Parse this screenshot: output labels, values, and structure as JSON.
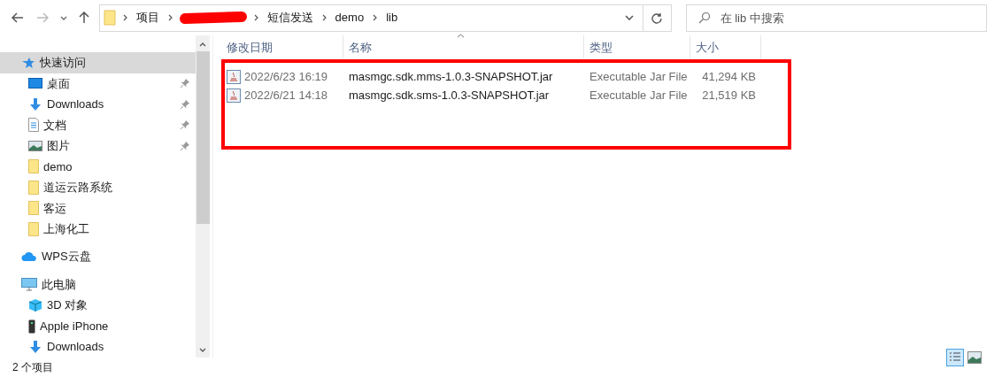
{
  "address_bar": {
    "segments": [
      {
        "kind": "text",
        "label": "项目"
      },
      {
        "kind": "redacted"
      },
      {
        "kind": "text",
        "label": "短信发送"
      },
      {
        "kind": "text",
        "label": "demo"
      },
      {
        "kind": "text",
        "label": "lib"
      }
    ]
  },
  "search": {
    "placeholder": "在 lib 中搜索"
  },
  "sidebar": {
    "items": [
      {
        "label": "快速访问",
        "kind": "star",
        "selected": true,
        "children": [
          {
            "label": "桌面",
            "kind": "desktop",
            "pinned": true,
            "selected": false
          },
          {
            "label": "Downloads",
            "kind": "download",
            "pinned": true,
            "selected": false
          },
          {
            "label": "文档",
            "kind": "document",
            "pinned": true,
            "selected": false
          },
          {
            "label": "图片",
            "kind": "image",
            "pinned": true,
            "selected": false
          },
          {
            "label": "demo",
            "kind": "folder",
            "pinned": false,
            "selected": false
          },
          {
            "label": "道运云路系统",
            "kind": "folder",
            "pinned": false,
            "selected": false
          },
          {
            "label": "客运",
            "kind": "folder",
            "pinned": false,
            "selected": false
          },
          {
            "label": "上海化工",
            "kind": "folder",
            "pinned": false,
            "selected": false
          }
        ]
      },
      {
        "label": "WPS云盘",
        "kind": "cloud",
        "selected": false
      },
      {
        "label": "此电脑",
        "kind": "pc",
        "selected": false,
        "children": [
          {
            "label": "3D 对象",
            "kind": "cube",
            "selected": false
          },
          {
            "label": "Apple iPhone",
            "kind": "phone",
            "selected": false
          },
          {
            "label": "Downloads",
            "kind": "download",
            "selected": false
          }
        ]
      }
    ]
  },
  "table": {
    "columns": [
      {
        "label": "修改日期",
        "sorted": false
      },
      {
        "label": "名称",
        "sorted": true
      },
      {
        "label": "类型",
        "sorted": false
      },
      {
        "label": "大小",
        "sorted": false
      }
    ],
    "rows": [
      {
        "date": "2022/6/23 16:19",
        "name": "masmgc.sdk.mms-1.0.3-SNAPSHOT.jar",
        "type": "Executable Jar File",
        "size": "41,294 KB"
      },
      {
        "date": "2022/6/21 14:18",
        "name": "masmgc.sdk.sms-1.0.3-SNAPSHOT.jar",
        "type": "Executable Jar File",
        "size": "21,519 KB"
      }
    ]
  },
  "annotation": {
    "kind": "red_box"
  },
  "status_bar": {
    "count": "2 个项目"
  },
  "view_buttons": [
    {
      "kind": "details",
      "selected": true
    },
    {
      "kind": "thumbnails",
      "selected": false
    }
  ]
}
